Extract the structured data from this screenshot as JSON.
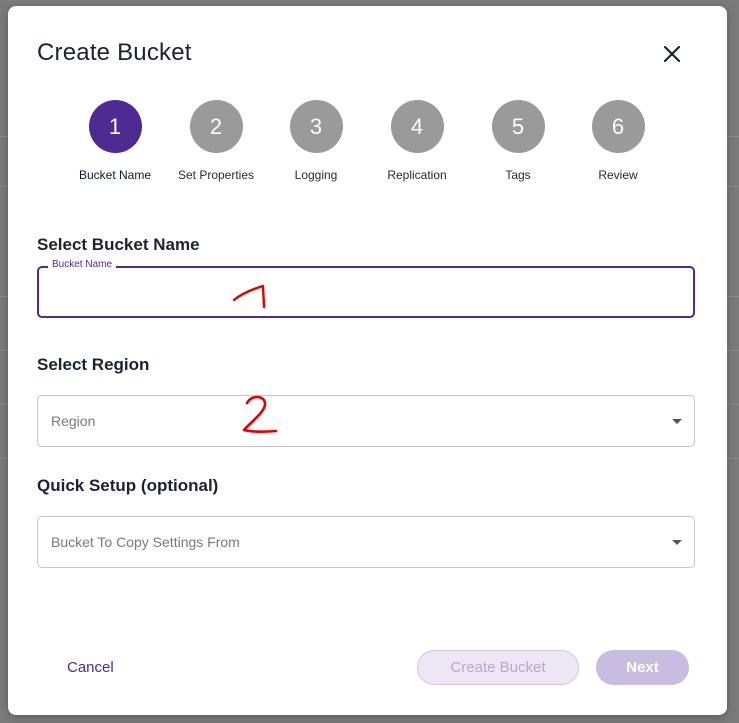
{
  "dialog": {
    "title": "Create Bucket",
    "close_icon": "close-icon"
  },
  "stepper": {
    "active_color": "#4e2a91",
    "inactive_color": "#9a9a9a",
    "steps": [
      {
        "number": "1",
        "label": "Bucket Name",
        "active": true
      },
      {
        "number": "2",
        "label": "Set Properties",
        "active": false
      },
      {
        "number": "3",
        "label": "Logging",
        "active": false
      },
      {
        "number": "4",
        "label": "Replication",
        "active": false
      },
      {
        "number": "5",
        "label": "Tags",
        "active": false
      },
      {
        "number": "6",
        "label": "Review",
        "active": false
      }
    ]
  },
  "bucket_name": {
    "section_label": "Select Bucket Name",
    "field_label": "Bucket Name",
    "value": ""
  },
  "region": {
    "section_label": "Select Region",
    "placeholder": "Region",
    "caret_icon": "caret-down-icon"
  },
  "quick_setup": {
    "section_label": "Quick Setup (optional)",
    "placeholder": "Bucket To Copy Settings From",
    "caret_icon": "caret-down-icon"
  },
  "annotations": {
    "mark_1": "1",
    "mark_2": "2",
    "color": "#e00000"
  },
  "footer": {
    "cancel_label": "Cancel",
    "create_label": "Create Bucket",
    "next_label": "Next"
  }
}
